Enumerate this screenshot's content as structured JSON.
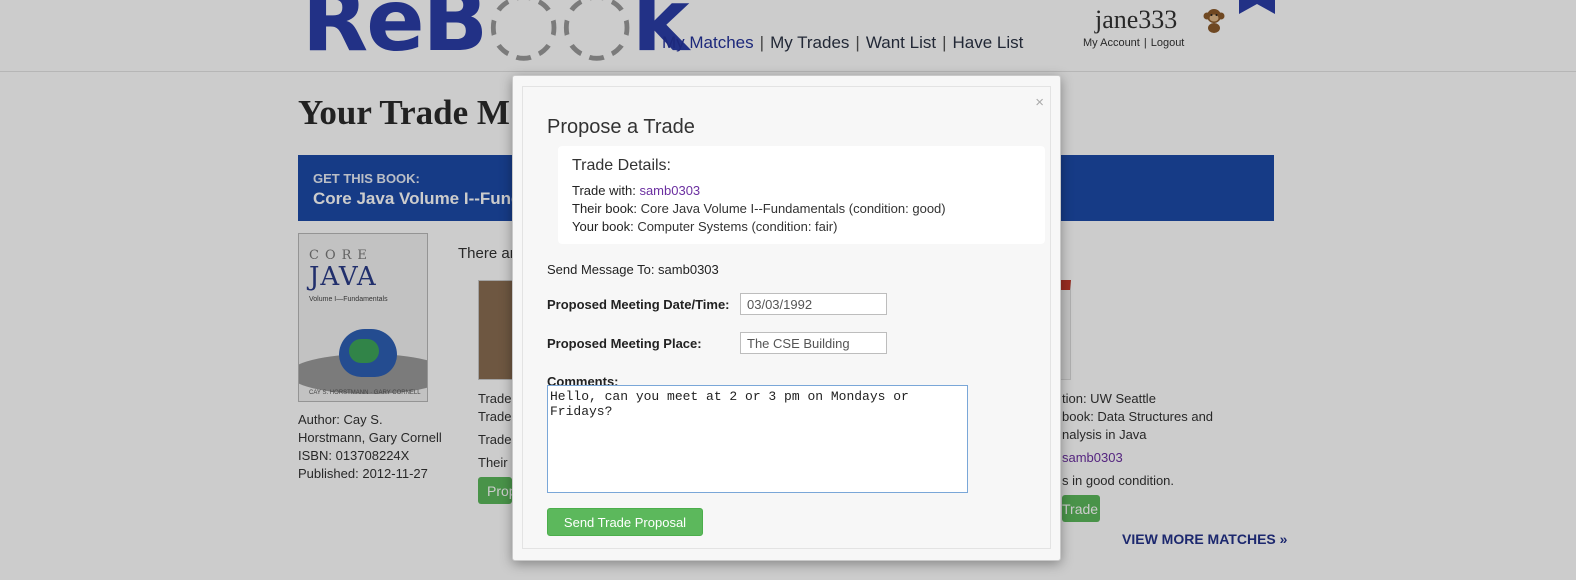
{
  "header": {
    "logo_text_a": "ReB",
    "logo_text_b": "k",
    "nav": [
      {
        "label": "My Matches"
      },
      {
        "label": "My Trades"
      },
      {
        "label": "Want List"
      },
      {
        "label": "Have List"
      }
    ],
    "nav_separator": "|",
    "username": "jane333",
    "account_link": "My Account",
    "logout_link": "Logout",
    "account_separator": "|"
  },
  "page": {
    "title": "Your Trade M",
    "banner_label": "GET THIS BOOK:",
    "banner_title": "Core Java Volume I--Funda",
    "book": {
      "cover_core": "CORE",
      "cover_java": "JAVA",
      "cover_volume": "Volume I—Fundamentals",
      "cover_authors": "CAY S. HORSTMANN · GARY CORNELL",
      "author_label": "Author:",
      "author_value_1": "Cay S.",
      "author_value_2": "Horstmann, Gary Cornell",
      "isbn_label": "ISBN:",
      "isbn_value": "013708224X",
      "published_label": "Published:",
      "published_value": "2012-11-27"
    },
    "there_are": "There ar",
    "bg_left_trade_1": "Trade",
    "bg_left_trade_2": "Trade",
    "bg_left_trade_3": "Trade",
    "bg_left_their": "Their b",
    "bg_left_button": "Prop",
    "bg_right_location": "tion: UW Seattle",
    "bg_right_book_1": "book: Data Structures and",
    "bg_right_book_2": "nalysis in Java",
    "bg_right_user": "samb0303",
    "bg_right_condition": "s in good condition.",
    "bg_right_button": "Trade",
    "view_more": "VIEW MORE MATCHES »"
  },
  "modal": {
    "close_glyph": "×",
    "title": "Propose a Trade",
    "details": {
      "heading": "Trade Details:",
      "trade_with_label": "Trade with:",
      "trade_with_value": "samb0303",
      "their_book_label": "Their book:",
      "their_book_value": "Core Java Volume I--Fundamentals (condition: good)",
      "your_book_label": "Your book:",
      "your_book_value": "Computer Systems (condition: fair)"
    },
    "send_message_to": "Send Message To: samb0303",
    "date_label": "Proposed Meeting Date/Time:",
    "date_value": "03/03/1992",
    "place_label": "Proposed Meeting Place:",
    "place_value": "The CSE Building",
    "comments_label": "Comments:",
    "comments_value": "Hello, can you meet at 2 or 3 pm on Mondays or Fridays?",
    "submit_label": "Send Trade Proposal"
  },
  "colors": {
    "brand_blue": "#2b3ea8",
    "banner_blue": "#1c4aa8",
    "button_green": "#5cb85c",
    "link_purple": "#6b2fa0"
  },
  "icons": {
    "avatar": "monkey-avatar-icon",
    "bookmark": "bookmark-ribbon-icon",
    "close": "close-icon",
    "logo_loop": "recycle-arrows-icon"
  }
}
